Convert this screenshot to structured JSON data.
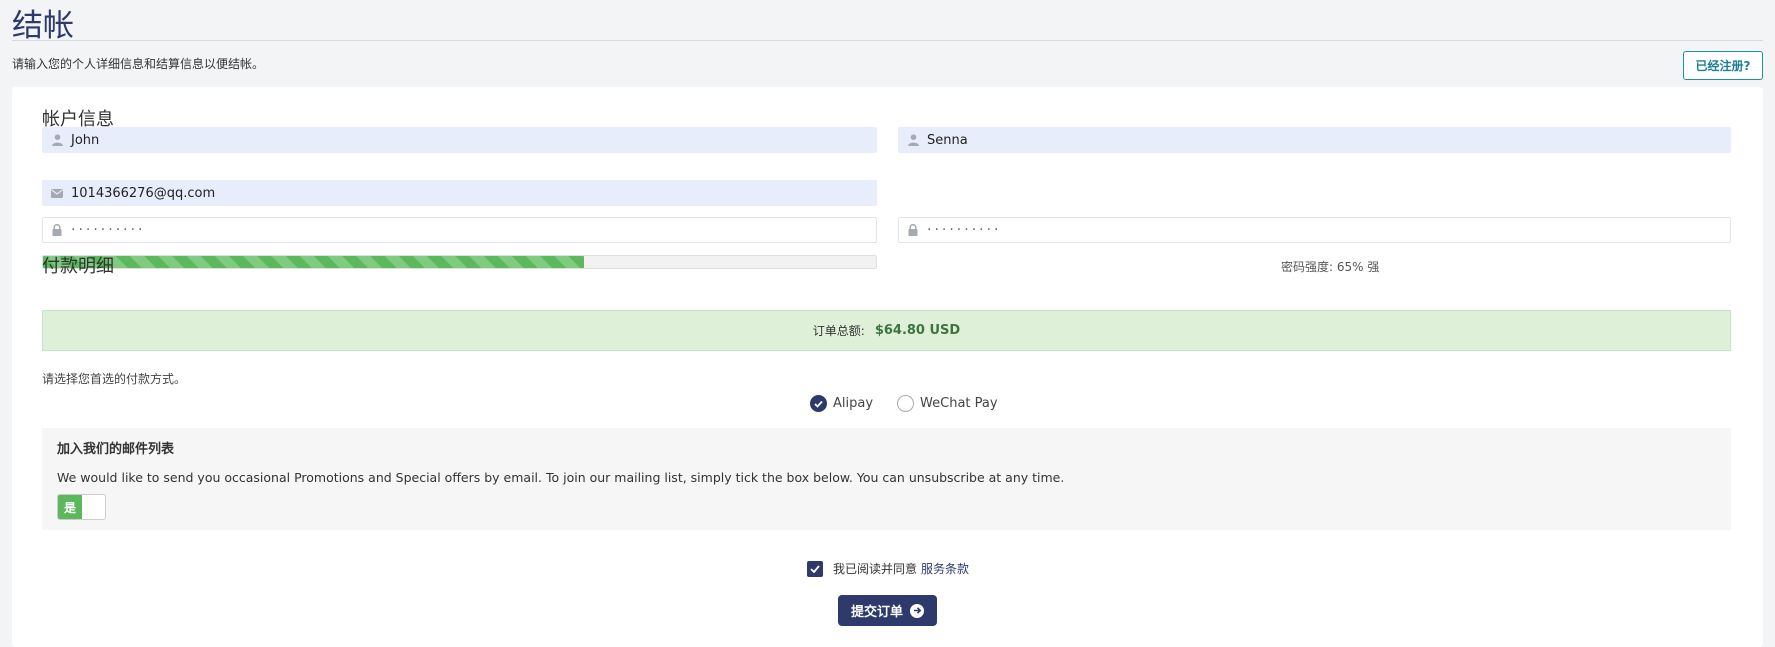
{
  "page": {
    "title": "结帐",
    "intro": "请输入您的个人详细信息和结算信息以便结帐。",
    "login_button": "已经注册?"
  },
  "account": {
    "section_title": "帐户信息",
    "first_name": "John",
    "last_name": "Senna",
    "email": "1014366276@qq.com",
    "password_mask": "··········",
    "password_confirm_mask": "··········",
    "strength_fraction": 0.65,
    "strength_text": "密码强度: 65% 强"
  },
  "payment": {
    "section_title": "付款明细",
    "total_label": "订单总额:",
    "total_amount": "$64.80 USD",
    "prompt": "请选择您首选的付款方式。",
    "options": [
      {
        "label": "Alipay",
        "selected": true
      },
      {
        "label": "WeChat Pay",
        "selected": false
      }
    ]
  },
  "mailing": {
    "title": "加入我们的邮件列表",
    "text": "We would like to send you occasional Promotions and Special offers by email. To join our mailing list, simply tick the box below. You can unsubscribe at any time.",
    "toggle_label": "是"
  },
  "terms": {
    "text": "我已阅读并同意",
    "link": "服务条款"
  },
  "submit": {
    "label": "提交订单"
  },
  "colors": {
    "brand": "#2d3a6b",
    "success": "#5cb85c",
    "accent_teal": "#1d8ea6"
  },
  "icons": {
    "name": "user-icon",
    "email": "envelope-icon",
    "password": "lock-icon",
    "radio_checked": "check-icon",
    "submit": "arrow-right-circle-icon"
  }
}
